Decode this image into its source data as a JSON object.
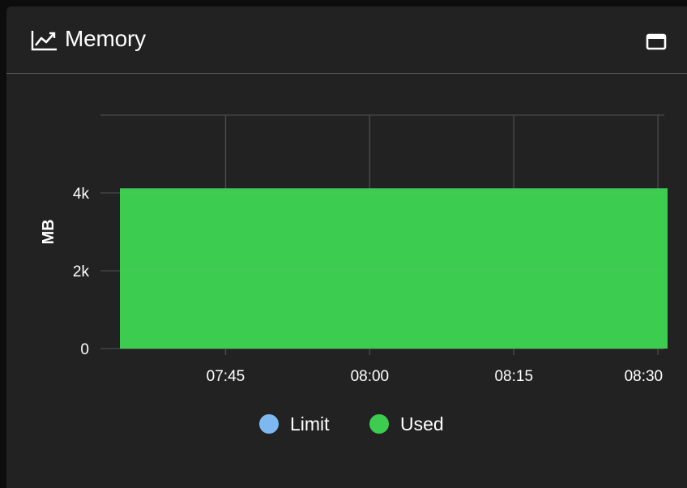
{
  "panel": {
    "title": "Memory",
    "title_icon": "line-chart-icon",
    "maximize_icon": "window-maximize-icon"
  },
  "chart_data": {
    "type": "area",
    "title": "Memory",
    "xlabel": "",
    "ylabel": "MB",
    "x_ticks": [
      "07:45",
      "08:00",
      "08:15",
      "08:30"
    ],
    "y_ticks": [
      "0",
      "2k",
      "4k"
    ],
    "ylim": [
      0,
      6000
    ],
    "grid": true,
    "legend_position": "bottom",
    "series": [
      {
        "name": "Limit",
        "color": "#7eb8f0",
        "x": [
          "07:34",
          "07:45",
          "08:00",
          "08:15",
          "08:30",
          "08:31"
        ],
        "values": [
          4096,
          4096,
          4096,
          4096,
          4096,
          4096
        ]
      },
      {
        "name": "Used",
        "color": "#3ccc50",
        "x": [
          "07:34",
          "07:45",
          "08:00",
          "08:15",
          "08:30",
          "08:31"
        ],
        "values": [
          4096,
          4096,
          4096,
          4096,
          4096,
          4096
        ]
      }
    ]
  }
}
